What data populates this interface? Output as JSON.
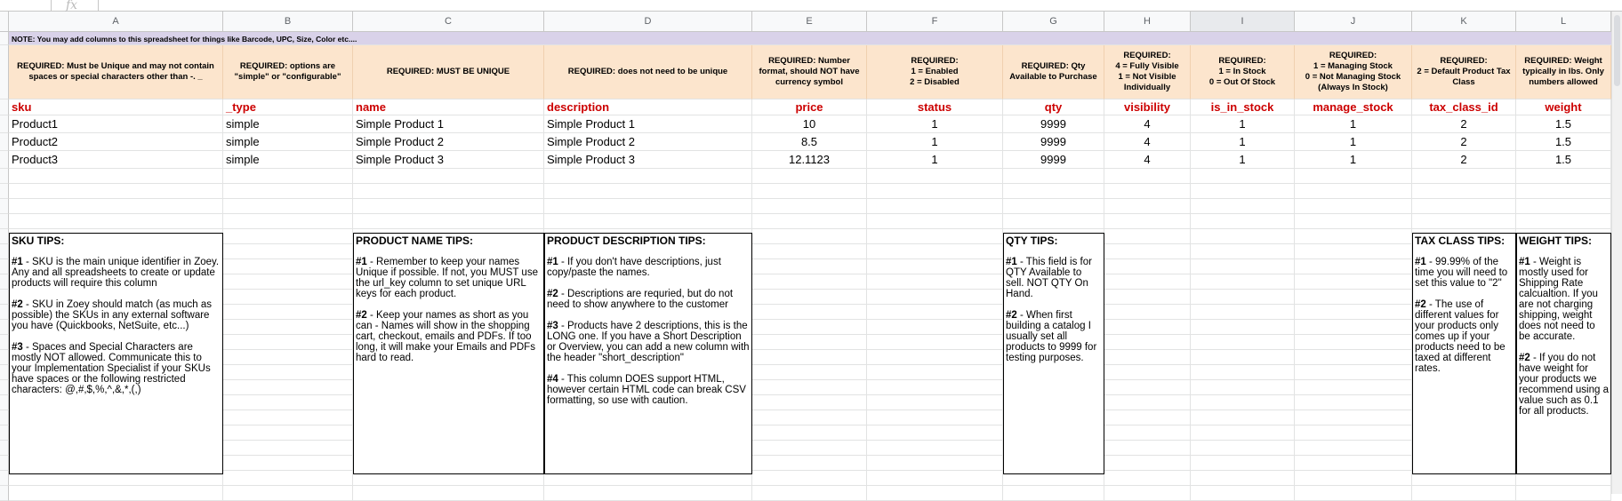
{
  "formula_bar": {
    "cell_ref": "",
    "fx": "fx"
  },
  "columns": [
    "A",
    "B",
    "C",
    "D",
    "E",
    "F",
    "G",
    "H",
    "I",
    "J",
    "K",
    "L"
  ],
  "selected_column": "I",
  "note": "NOTE: You may add columns to this spreadsheet for things like Barcode, UPC, Size, Color etc....",
  "requirements": [
    "REQUIRED: Must be Unique and may not contain spaces or special characters other than -. _",
    "REQUIRED: options are \"simple\" or \"configurable\"",
    "REQUIRED: MUST BE UNIQUE",
    "REQUIRED: does not need to be unique",
    "REQUIRED: Number format, should NOT have currency symbol",
    "REQUIRED:\n1 = Enabled\n2 = Disabled",
    "REQUIRED: Qty Available to Purchase",
    "REQUIRED:\n4 = Fully Visible\n1 = Not Visible Individually",
    "REQUIRED:\n1 = In Stock\n0 = Out Of Stock",
    "REQUIRED:\n1 = Managing Stock\n0 = Not Managing Stock (Always In Stock)",
    "REQUIRED:\n2 = Default Product Tax Class",
    "REQUIRED: Weight typically in lbs. Only numbers allowed"
  ],
  "headers": [
    "sku",
    "_type",
    "name",
    "description",
    "price",
    "status",
    "qty",
    "visibility",
    "is_in_stock",
    "manage_stock",
    "tax_class_id",
    "weight"
  ],
  "rows": [
    [
      "Product1",
      "simple",
      "Simple Product 1",
      "Simple Product 1",
      "10",
      "1",
      "9999",
      "4",
      "1",
      "1",
      "2",
      "1.5"
    ],
    [
      "Product2",
      "simple",
      "Simple Product 2",
      "Simple Product 2",
      "8.5",
      "1",
      "9999",
      "4",
      "1",
      "1",
      "2",
      "1.5"
    ],
    [
      "Product3",
      "simple",
      "Simple Product 3",
      "Simple Product 3",
      "12.1123",
      "1",
      "9999",
      "4",
      "1",
      "1",
      "2",
      "1.5"
    ]
  ],
  "tips": {
    "sku": {
      "title": "SKU TIPS:",
      "body": [
        {
          "n": "#1",
          "t": " - SKU is the main unique identifier in Zoey. Any and all spreadsheets to create or update products will require this column"
        },
        {
          "n": "#2",
          "t": " - SKU in Zoey should match (as much as possible) the SKUs in any external software you have (Quickbooks, NetSuite, etc...)"
        },
        {
          "n": "#3",
          "t": " - Spaces and Special Characters are mostly NOT allowed. Communicate this to your Implementation Specialist if your SKUs have spaces or the following restricted characters: @,#,$,%,^,&,*,(,)"
        }
      ]
    },
    "name": {
      "title": "PRODUCT NAME TIPS:",
      "body": [
        {
          "n": "#1",
          "t": " - Remember to keep your names Unique if possible. If not, you MUST use the url_key column to set unique URL keys for each product."
        },
        {
          "n": "#2",
          "t": " - Keep your names as short as you can - Names will show in the shopping cart, checkout, emails and PDFs. If too long, it will make your Emails and PDFs hard to read."
        }
      ]
    },
    "description": {
      "title": "PRODUCT DESCRIPTION TIPS:",
      "body": [
        {
          "n": "#1",
          "t": " - If you don't have descriptions, just copy/paste the names."
        },
        {
          "n": "#2",
          "t": " - Descriptions are requried, but do not need to show anywhere to the customer"
        },
        {
          "n": "#3",
          "t": " - Products have 2 descriptions, this is the LONG one. If you have a Short Description or Overview, you can add a new column with the header \"short_description\""
        },
        {
          "n": "#4",
          "t": " - This column DOES support HTML, however certain HTML code can break CSV formatting, so use with caution."
        }
      ]
    },
    "qty": {
      "title": "QTY TIPS:",
      "body": [
        {
          "n": "#1",
          "t": " - This field is for QTY Available to sell. NOT QTY On Hand."
        },
        {
          "n": "#2",
          "t": " - When first building a catalog I usually set all products to 9999 for testing purposes."
        }
      ]
    },
    "tax": {
      "title": "TAX CLASS TIPS:",
      "body": [
        {
          "n": "#1",
          "t": " - 99.99% of the time you will need to set this value to \"2\""
        },
        {
          "n": "#2",
          "t": " - The use of different values for your products only comes up if your products need to be taxed at different rates."
        }
      ]
    },
    "weight": {
      "title": "WEIGHT TIPS:",
      "body": [
        {
          "n": "#1",
          "t": " - Weight is mostly used for Shipping Rate calcualtion. If you are not charging shipping, weight does not need to be accurate."
        },
        {
          "n": "#2",
          "t": " - If you do not have weight for your products we recommend using a value such as 0.1 for all products."
        }
      ]
    }
  }
}
